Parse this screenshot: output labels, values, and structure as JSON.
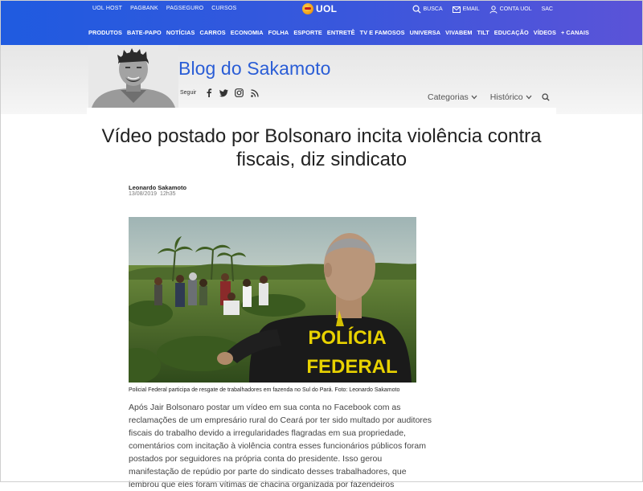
{
  "topbar": {
    "links": [
      "UOL HOST",
      "PAGBANK",
      "PAGSEGURO",
      "CURSOS"
    ],
    "logo_text": "UOL",
    "tools": [
      {
        "label": "BUSCA",
        "icon": "search-icon"
      },
      {
        "label": "EMAIL",
        "icon": "mail-icon"
      },
      {
        "label": "CONTA UOL",
        "icon": "user-icon"
      },
      {
        "label": "SAC",
        "icon": ""
      }
    ],
    "nav": [
      "PRODUTOS",
      "BATE-PAPO",
      "NOTÍCIAS",
      "CARROS",
      "ECONOMIA",
      "FOLHA",
      "ESPORTE",
      "ENTRETÊ",
      "TV E FAMOSOS",
      "UNIVERSA",
      "VIVABEM",
      "TILT",
      "EDUCAÇÃO",
      "VÍDEOS",
      "+ CANAIS"
    ]
  },
  "blog": {
    "title": "Blog do Sakamoto",
    "follow_label": "Seguir",
    "social": [
      "facebook-icon",
      "twitter-icon",
      "instagram-icon",
      "rss-icon"
    ],
    "menu": {
      "categories": "Categorias",
      "history": "Histórico"
    }
  },
  "article": {
    "headline": "Vídeo postado por Bolsonaro incita violência contra fiscais, diz sindicato",
    "author": "Leonardo Sakamoto",
    "date": "13/08/2019",
    "time": "12h35",
    "photo_vest_text": [
      "POLÍCIA",
      "FEDERAL"
    ],
    "caption": "Policial Federal participa de resgate de trabalhadores em fazenda no Sul do Pará. Foto: Leonardo Sakamoto",
    "body": "Após Jair Bolsonaro postar um vídeo em sua conta no Facebook com as reclamações de um empresário rural do Ceará por ter sido multado por auditores fiscais do trabalho devido a irregularidades flagradas em sua propriedade, comentários com incitação à violência contra esses funcionários públicos foram postados por seguidores na própria conta do presidente. Isso gerou manifestação de repúdio por parte do sindicato desses trabalhadores, que lembrou que eles foram vítimas de chacina organizada por fazendeiros"
  },
  "colors": {
    "topbar_start": "#1f5be0",
    "topbar_end": "#5b53d8",
    "blog_title": "#2a5dd6"
  }
}
